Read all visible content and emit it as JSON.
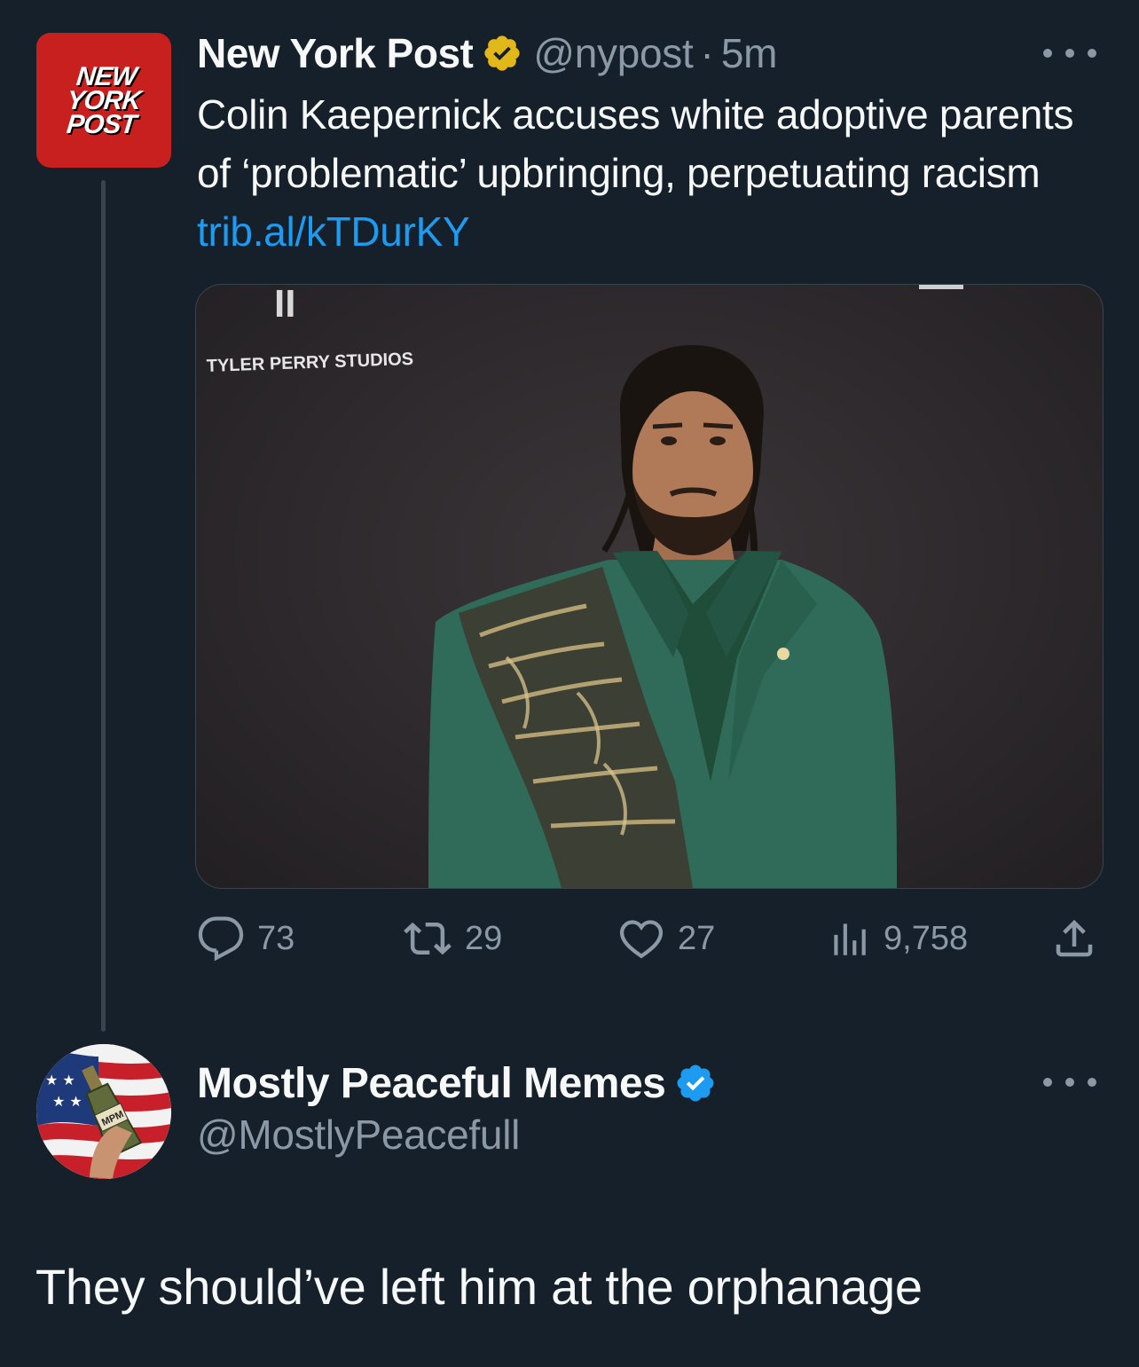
{
  "tweet": {
    "avatar_lines": [
      "NEW",
      "YORK",
      "POST"
    ],
    "display_name": "New York Post",
    "badge": "gold-verified-badge-icon",
    "handle": "@nypost",
    "separator": "·",
    "time": "5m",
    "text": "Colin Kaepernick accuses white adoptive parents of ‘problematic’ upbringing, perpetuating racism ",
    "link": "trib.al/kTDurKY",
    "image": {
      "backdrop_text": "TYLER PERRY STUDIOS",
      "logo_mark": "II"
    },
    "stats": {
      "replies": "73",
      "reposts": "29",
      "likes": "27",
      "views": "9,758"
    }
  },
  "reply": {
    "display_name": "Mostly Peaceful Memes",
    "badge": "blue-verified-badge-icon",
    "handle": "@MostlyPeacefull",
    "avatar_label": "MPM",
    "text": "They should’ve left him at the orphanage"
  },
  "colors": {
    "background": "#15202b",
    "text_primary": "#f7f9f9",
    "text_secondary": "#8b98a5",
    "link": "#1d9bf0",
    "gold_badge": "#e2b719",
    "blue_badge": "#1d9bf0",
    "nyp_red": "#c8201f"
  }
}
